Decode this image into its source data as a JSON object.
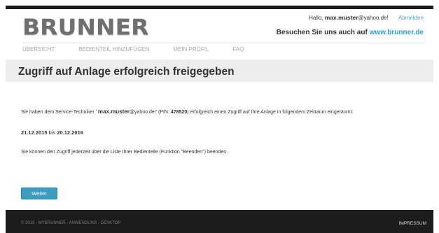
{
  "header": {
    "logo_text": "BRUNNER",
    "greeting_prefix": "Hallo,",
    "username": "max.muster",
    "email_domain": "@yahoo.de!",
    "logout_label": "Abmelden",
    "visit_text": "Besuchen Sie uns auch auf",
    "visit_link": "www.brunner.de"
  },
  "nav": {
    "items": [
      {
        "label": "ÜBERSICHT"
      },
      {
        "label": "BEDIENTEIL HINZUFÜGEN"
      },
      {
        "label": "MEIN PROFIL"
      },
      {
        "label": "FAQ"
      }
    ]
  },
  "page": {
    "title": "Zugriff auf Anlage erfolgreich freigegeben"
  },
  "content": {
    "para1_prefix": "Sie haben dem Service-Techniker ' ",
    "para1_user": "max.muster",
    "para1_email": "@yahoo.de!' (PIN: ",
    "para1_pin": "478520",
    "para1_suffix": ") erfolgreich einen Zugriff auf Ihre Anlage in folgendem Zeitraum eingeräumt:",
    "date_from": "21.12.2015",
    "date_sep": "bis",
    "date_to": "20.12.2016",
    "para2": "Sie können den Zugriff jederzeit über die Liste Ihrer Bedienteile (Funktion \"Beenden\") beenden.",
    "button_label": "Weiter"
  },
  "footer": {
    "copyright": "© 2015 - MYBRUNNER - ANWENDUNG - DESKTOP",
    "imprint": "IMPRESSUM"
  },
  "colors": {
    "accent": "#3e9cc1",
    "link": "#3a9cc3",
    "footer_bg": "#1c1c1c",
    "title_bar": "#ececec"
  }
}
